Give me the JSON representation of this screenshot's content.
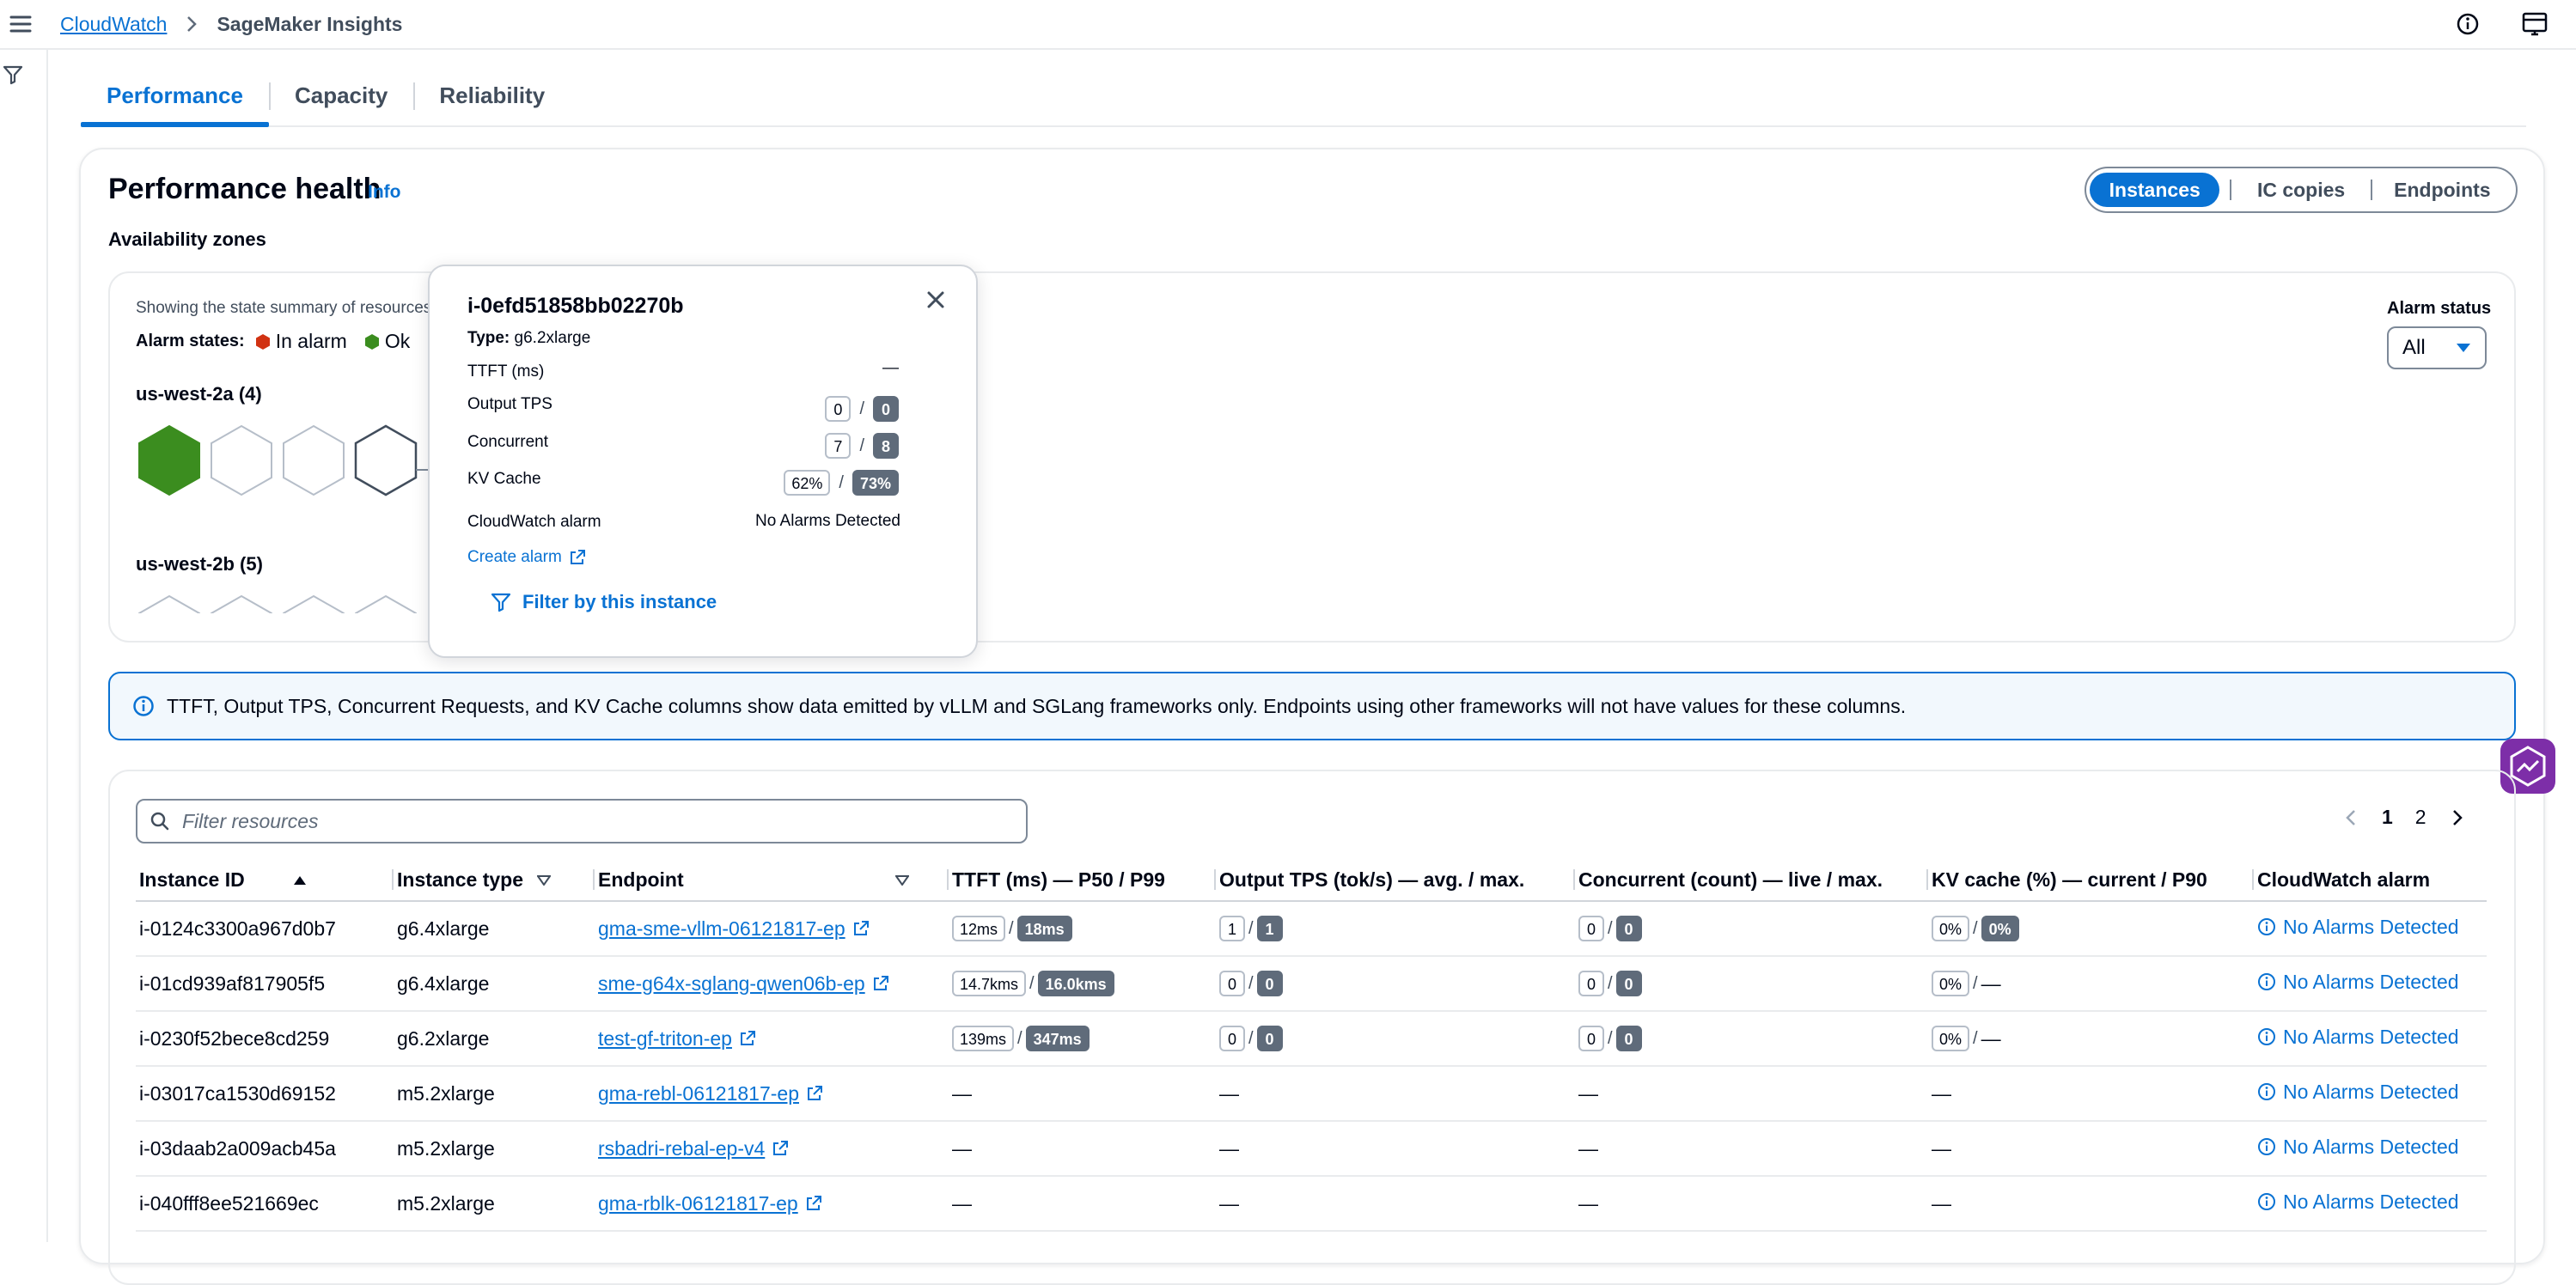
{
  "breadcrumb": {
    "root": "CloudWatch",
    "current": "SageMaker Insights"
  },
  "tabs": [
    "Performance",
    "Capacity",
    "Reliability"
  ],
  "section": {
    "title": "Performance health",
    "info": "Info",
    "view_toggle": [
      "Instances",
      "IC copies",
      "Endpoints"
    ],
    "az_label": "Availability zones"
  },
  "az_panel": {
    "summary": "Showing the state summary of resources",
    "alarm_states_label": "Alarm states:",
    "state_in_alarm": "In alarm",
    "state_ok": "Ok",
    "zones": [
      {
        "label": "us-west-2a (4)"
      },
      {
        "label": "us-west-2b (5)"
      }
    ],
    "alarm_status_label": "Alarm status",
    "alarm_status_value": "All",
    "colors": {
      "ok": "#3b8d1f",
      "in_alarm": "#d13212",
      "hex_outline": "#7d8998"
    }
  },
  "popover": {
    "instance_id": "i-0efd51858bb02270b",
    "type_label": "Type:",
    "type_value": "g6.2xlarge",
    "ttft_label": "TTFT (ms)",
    "ttft_value": "—",
    "tps_label": "Output TPS",
    "tps_a": "0",
    "tps_b": "0",
    "conc_label": "Concurrent",
    "conc_a": "7",
    "conc_b": "8",
    "kv_label": "KV Cache",
    "kv_a": "62%",
    "kv_b": "73%",
    "cw_label": "CloudWatch alarm",
    "cw_value": "No Alarms Detected",
    "create_alarm": "Create alarm",
    "filter_action": "Filter by this instance"
  },
  "alert": {
    "text": "TTFT, Output TPS, Concurrent Requests, and KV Cache columns show data emitted by vLLM and SGLang frameworks only. Endpoints using other frameworks will not have values for these columns."
  },
  "table": {
    "search_placeholder": "Filter resources",
    "pages": [
      "1",
      "2"
    ],
    "headers": {
      "instance_id": "Instance ID",
      "instance_type": "Instance type",
      "endpoint": "Endpoint",
      "ttft": "TTFT (ms) — P50 / P99",
      "tps": "Output TPS (tok/s) — avg. / max.",
      "concurrent": "Concurrent (count) — live / max.",
      "kv": "KV cache (%) — current / P90",
      "cw": "CloudWatch alarm"
    },
    "dash": "—",
    "rows": [
      {
        "id": "i-0124c3300a967d0b7",
        "type": "g6.4xlarge",
        "endpoint": "gma-sme-vllm-06121817-ep",
        "ttft": [
          "12ms",
          "18ms"
        ],
        "tps": [
          "1",
          "1"
        ],
        "conc": [
          "0",
          "0"
        ],
        "kv": [
          "0%",
          "0%"
        ],
        "cw": "No Alarms Detected"
      },
      {
        "id": "i-01cd939af817905f5",
        "type": "g6.4xlarge",
        "endpoint": "sme-g64x-sglang-qwen06b-ep",
        "ttft": [
          "14.7kms",
          "16.0kms"
        ],
        "tps": [
          "0",
          "0"
        ],
        "conc": [
          "0",
          "0"
        ],
        "kv": [
          "0%",
          "—"
        ],
        "cw": "No Alarms Detected"
      },
      {
        "id": "i-0230f52bece8cd259",
        "type": "g6.2xlarge",
        "endpoint": "test-gf-triton-ep",
        "ttft": [
          "139ms",
          "347ms"
        ],
        "tps": [
          "0",
          "0"
        ],
        "conc": [
          "0",
          "0"
        ],
        "kv": [
          "0%",
          "—"
        ],
        "cw": "No Alarms Detected"
      },
      {
        "id": "i-03017ca1530d69152",
        "type": "m5.2xlarge",
        "endpoint": "gma-rebl-06121817-ep",
        "ttft": null,
        "tps": null,
        "conc": null,
        "kv": null,
        "cw": "No Alarms Detected"
      },
      {
        "id": "i-03daab2a009acb45a",
        "type": "m5.2xlarge",
        "endpoint": "rsbadri-rebal-ep-v4",
        "ttft": null,
        "tps": null,
        "conc": null,
        "kv": null,
        "cw": "No Alarms Detected"
      },
      {
        "id": "i-040fff8ee521669ec",
        "type": "m5.2xlarge",
        "endpoint": "gma-rblk-06121817-ep",
        "ttft": null,
        "tps": null,
        "conc": null,
        "kv": null,
        "cw": "No Alarms Detected"
      }
    ]
  }
}
